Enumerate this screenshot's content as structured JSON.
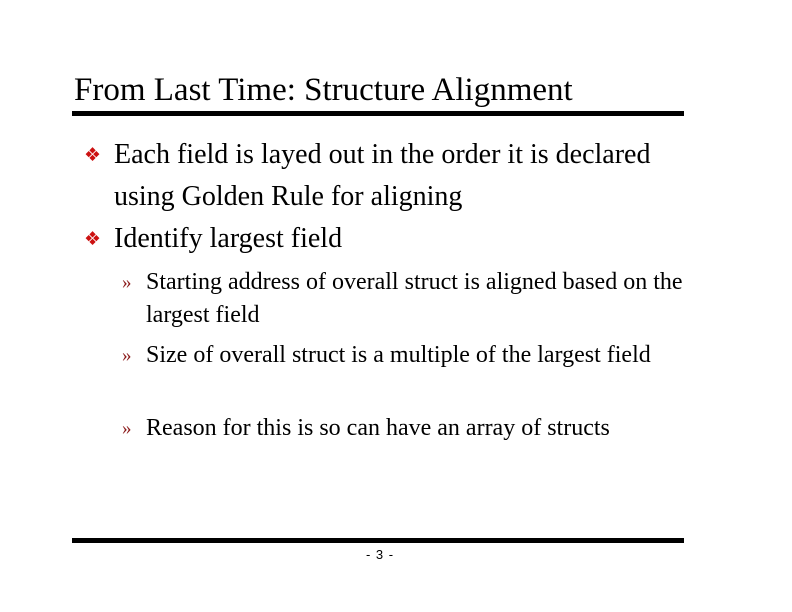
{
  "slide": {
    "title": "From Last Time: Structure Alignment",
    "bullet_icon": "four-diamond-bullet-icon",
    "sub_bullet_icon": "double-angle-bullet-icon",
    "bullet_glyph": "❖",
    "sub_bullet_glyph": "»",
    "colors": {
      "bullet": "#cc1111",
      "sub_bullet": "#8b1a1a",
      "text": "#000000",
      "rule": "#000000"
    },
    "bullets": [
      {
        "text": "Each field is layed out in the order it is declared using Golden Rule for aligning",
        "sub_bullets": []
      },
      {
        "text": "Identify largest field",
        "sub_bullets": [
          {
            "text": "Starting address of overall struct is aligned based on the largest field"
          },
          {
            "text": "Size of overall struct is a multiple of the largest field"
          },
          {
            "text": "Reason for this is so can have an array of structs"
          }
        ]
      }
    ],
    "page_number": "- 3 -"
  }
}
